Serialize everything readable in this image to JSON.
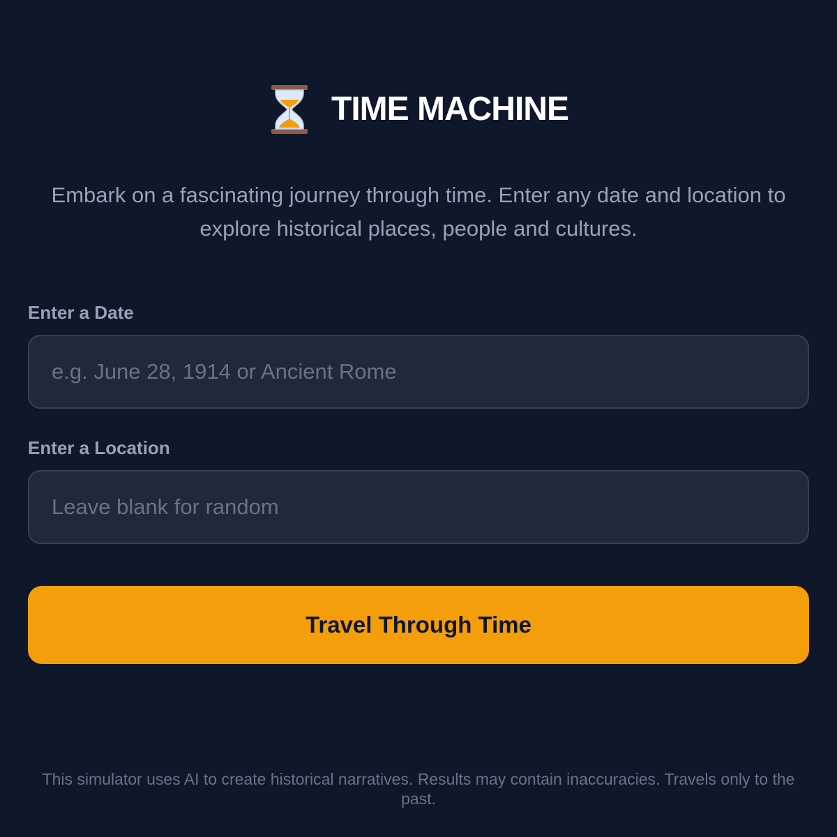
{
  "header": {
    "icon": "hourglass-icon",
    "title": "TIME MACHINE"
  },
  "intro": {
    "text": "Embark on a fascinating journey through time. Enter any date and location to explore historical places, people and cultures."
  },
  "form": {
    "date": {
      "label": "Enter a Date",
      "placeholder": "e.g. June 28, 1914 or Ancient Rome",
      "value": ""
    },
    "location": {
      "label": "Enter a Location",
      "placeholder": "Leave blank for random",
      "value": ""
    },
    "submit_label": "Travel Through Time"
  },
  "footer": {
    "disclaimer": "This simulator uses AI to create historical narratives. Results may contain inaccuracies. Travels only to the past."
  },
  "colors": {
    "background": "#0f172a",
    "input_background": "#1e293b",
    "input_border": "#334155",
    "accent": "#f59e0b",
    "muted_text": "#94a3b8"
  }
}
